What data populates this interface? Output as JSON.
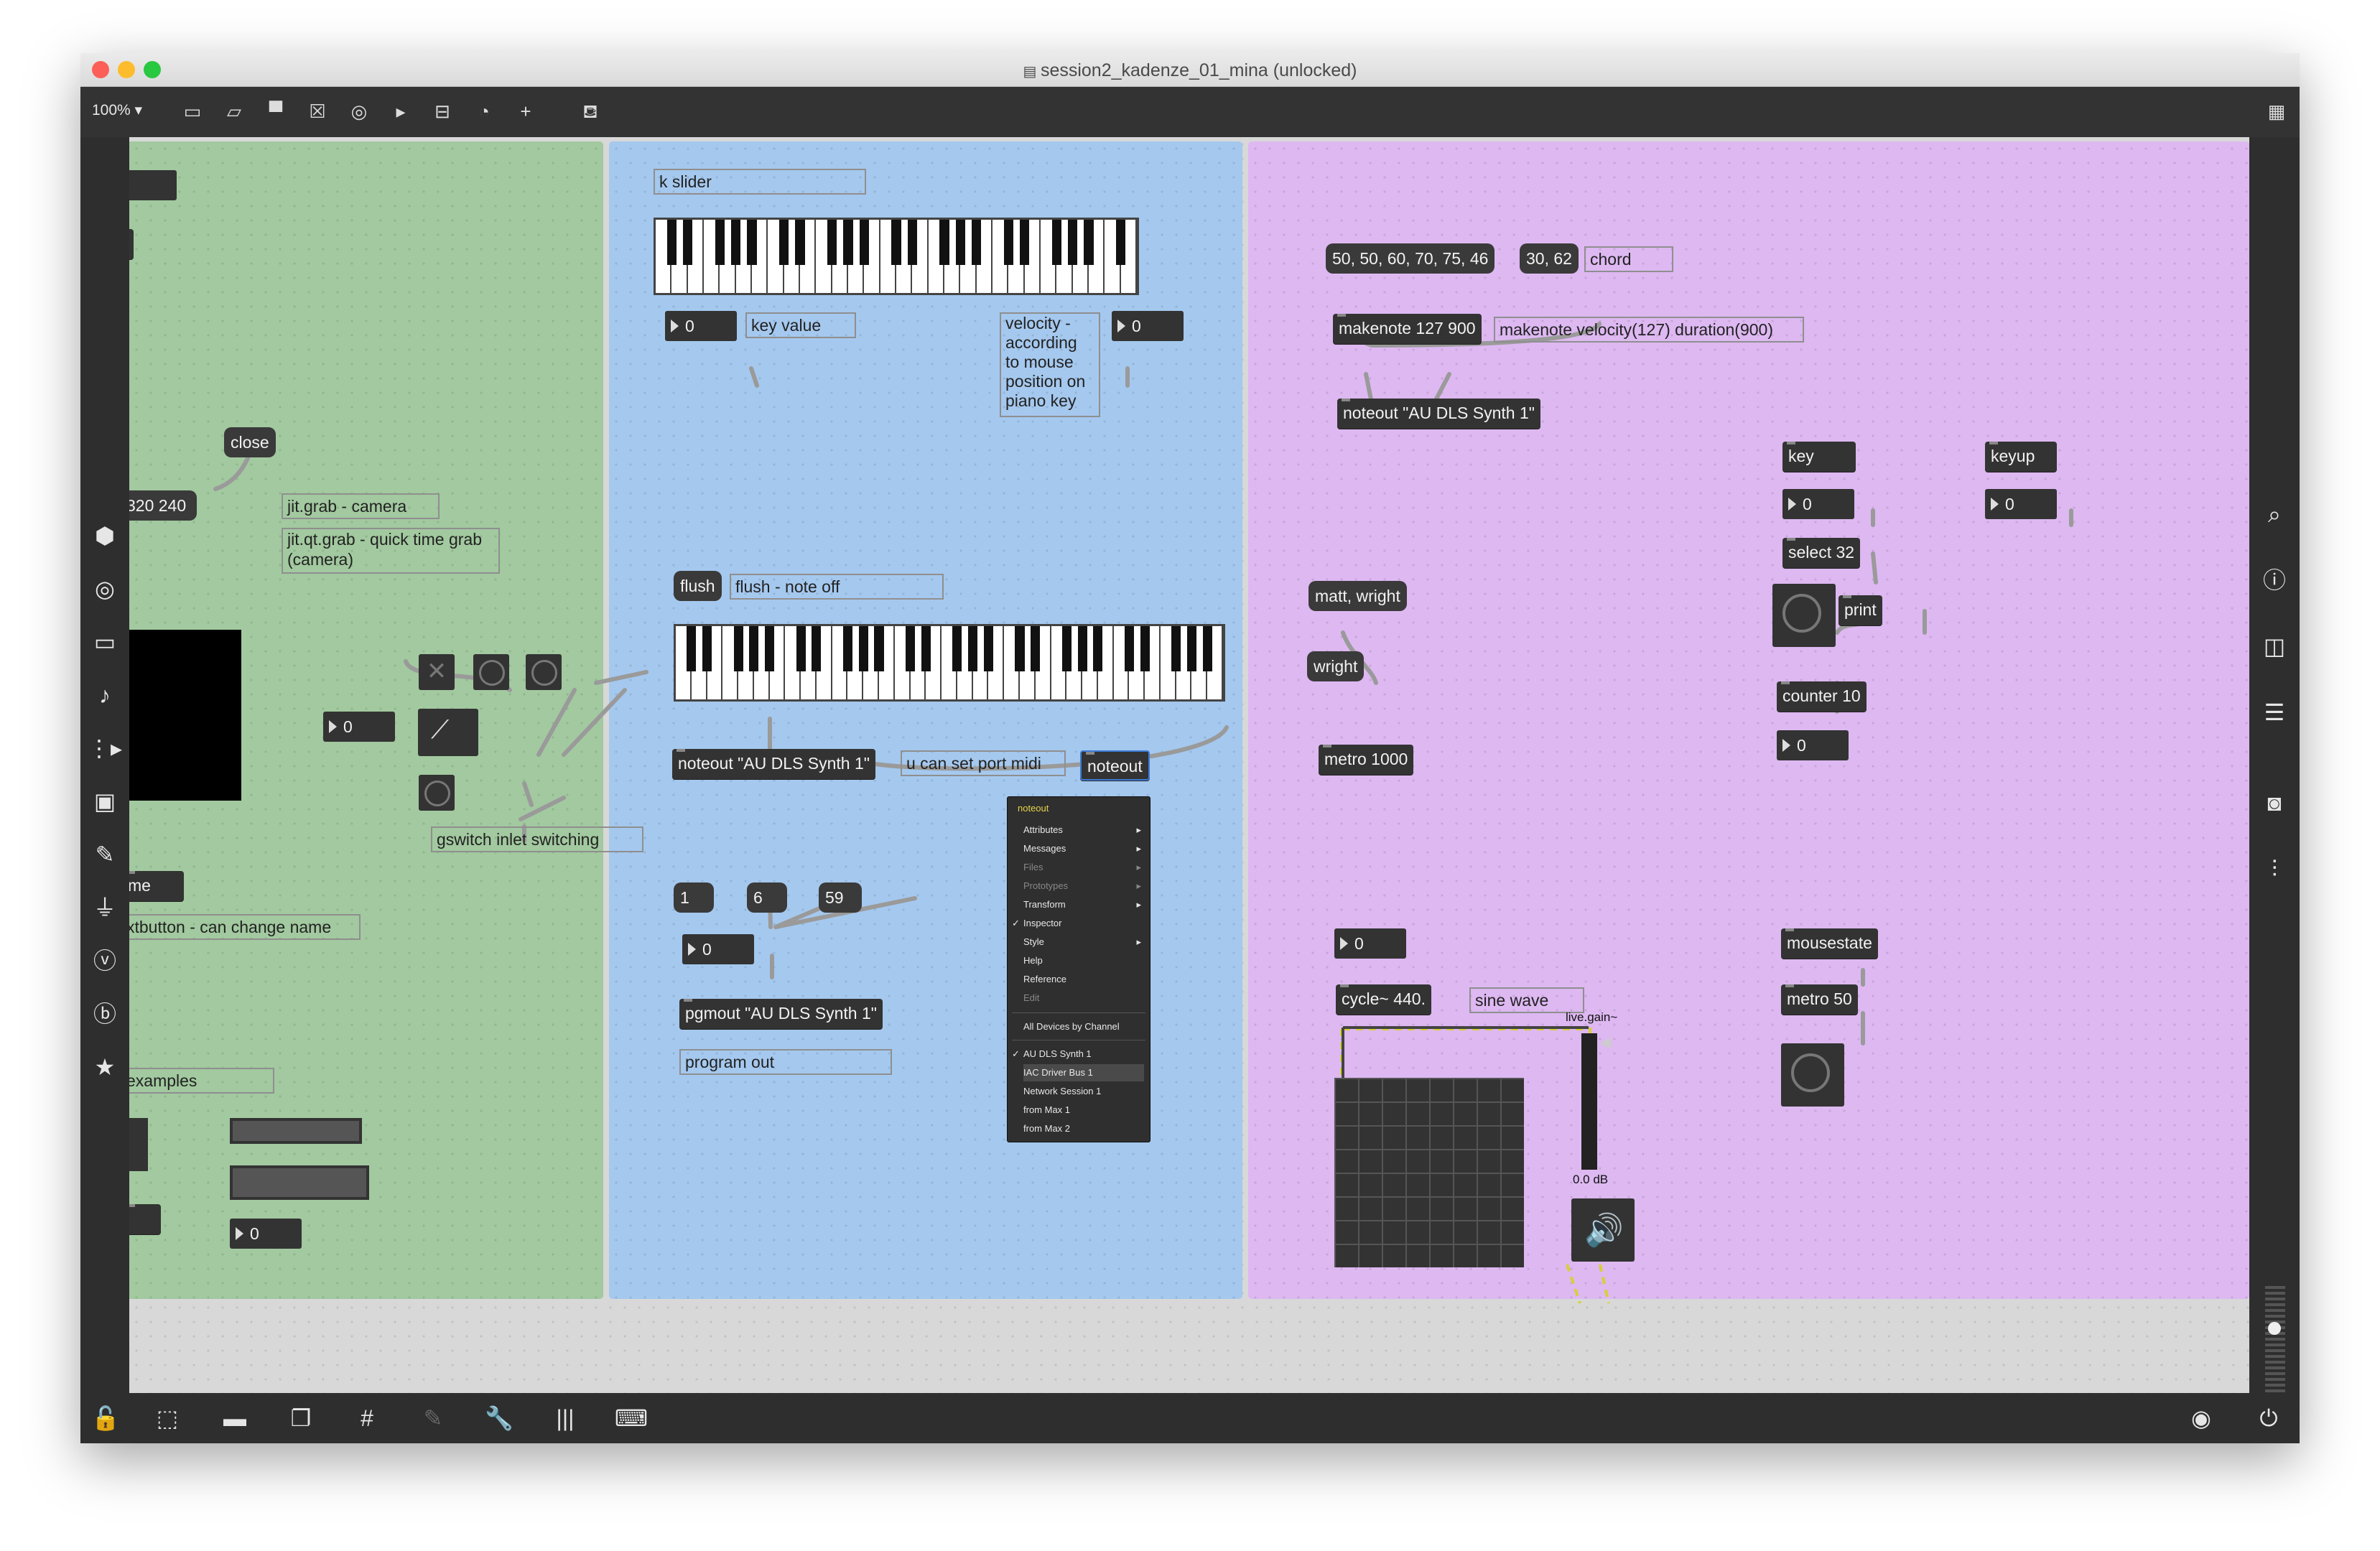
{
  "window": {
    "title": "session2_kadenze_01_mina (unlocked)"
  },
  "toolbar": {
    "zoom": "100%"
  },
  "colors": {
    "green_panel": "#a2c99f",
    "blue_panel": "#a5c8ee",
    "purple_panel": "#ddb8f1"
  },
  "green": {
    "msg_close": "close",
    "msg_320": "320 240",
    "cmt_jitgrab": "jit.grab - camera",
    "cmt_jitqt": "jit.qt.grab - quick time grab (camera)",
    "num_zero": "0",
    "cmt_gswitch": "gswitch inlet switching",
    "obj_me": "me",
    "cmt_textbutton": "xtbutton - can change name",
    "cmt_examples": "examples",
    "num_bottom": "0",
    "num_top": "0"
  },
  "blue": {
    "cmt_kslider": "k slider",
    "num_key": "0",
    "cmt_keyvalue": "key value",
    "cmt_velocity": "velocity - according to mouse position on piano key",
    "num_vel": "0",
    "msg_flush": "flush",
    "cmt_flush": "flush - note off",
    "obj_noteout": "noteout \"AU DLS Synth 1\"",
    "cmt_portmidi": "u can set port midi",
    "obj_noteout2": "noteout",
    "msg_1": "1",
    "msg_6": "6",
    "msg_59": "59",
    "num_pgm": "0",
    "obj_pgmout": "pgmout \"AU DLS Synth 1\"",
    "cmt_program": "program out"
  },
  "context_menu": {
    "title": "noteout",
    "items": [
      {
        "label": "Attributes",
        "sub": "▸",
        "disabled": false,
        "checked": ""
      },
      {
        "label": "Messages",
        "sub": "▸",
        "disabled": false,
        "checked": ""
      },
      {
        "label": "Files",
        "sub": "▸",
        "disabled": true,
        "checked": ""
      },
      {
        "label": "Prototypes",
        "sub": "▸",
        "disabled": true,
        "checked": ""
      },
      {
        "label": "Transform",
        "sub": "▸",
        "disabled": false,
        "checked": ""
      },
      {
        "label": "Inspector",
        "sub": "",
        "disabled": false,
        "checked": "✓"
      },
      {
        "label": "Style",
        "sub": "▸",
        "disabled": false,
        "checked": ""
      },
      {
        "label": "Help",
        "sub": "",
        "disabled": false,
        "checked": ""
      },
      {
        "label": "Reference",
        "sub": "",
        "disabled": false,
        "checked": ""
      },
      {
        "label": "Edit",
        "sub": "",
        "disabled": true,
        "checked": ""
      }
    ],
    "devices_header": "All Devices by Channel",
    "devices": [
      {
        "label": "AU DLS Synth 1",
        "checked": "✓"
      },
      {
        "label": "IAC Driver Bus 1",
        "checked": ""
      },
      {
        "label": "Network Session 1",
        "checked": ""
      },
      {
        "label": "from Max 1",
        "checked": ""
      },
      {
        "label": "from Max 2",
        "checked": ""
      }
    ]
  },
  "purple": {
    "msg_list": "50, 50, 60, 70, 75, 46",
    "msg_3062": "30, 62",
    "cmt_chord": "chord",
    "obj_makenote": "makenote 127 900",
    "cmt_makenote": "makenote velocity(127) duration(900)",
    "obj_noteout": "noteout \"AU DLS Synth 1\"",
    "obj_key": "key",
    "num_key": "0",
    "obj_keyup": "keyup",
    "num_keyup": "0",
    "obj_select": "select 32",
    "obj_print": "print",
    "obj_counter": "counter 10",
    "num_counter": "0",
    "msg_matt": "matt, wright",
    "msg_wright": "wright",
    "obj_metro1000": "metro 1000",
    "num_freq": "0",
    "obj_cycle": "cycle~ 440.",
    "cmt_sine": "sine wave",
    "lbl_livegain": "live.gain~",
    "lbl_db": "0.0 dB",
    "obj_mousestate": "mousestate",
    "obj_metro50": "metro 50"
  }
}
